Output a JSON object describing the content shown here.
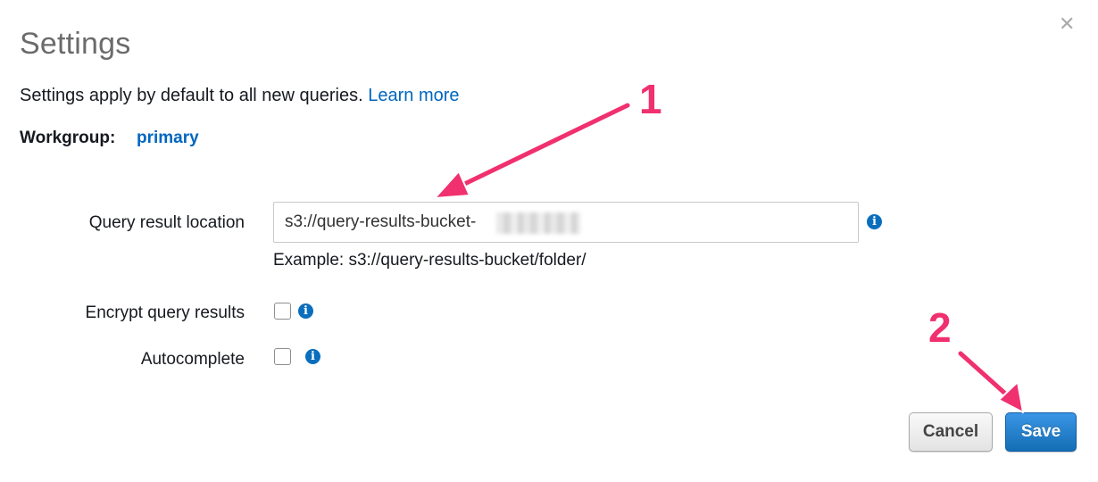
{
  "dialog": {
    "title": "Settings",
    "description": "Settings apply by default to all new queries.",
    "learn_more": "Learn more",
    "close_glyph": "✕"
  },
  "workgroup": {
    "label": "Workgroup:",
    "value": "primary"
  },
  "query_result_location": {
    "label": "Query result location",
    "value": "s3://query-results-bucket-",
    "example": "Example: s3://query-results-bucket/folder/"
  },
  "encrypt_query_results": {
    "label": "Encrypt query results",
    "checked": false
  },
  "autocomplete": {
    "label": "Autocomplete",
    "checked": false
  },
  "buttons": {
    "cancel": "Cancel",
    "save": "Save"
  },
  "annotations": {
    "marker_1": "1",
    "marker_2": "2",
    "color": "#f0306f"
  },
  "colors": {
    "link": "#0066c0",
    "info_icon": "#0a6ebd",
    "save_button": "#146eb4"
  }
}
